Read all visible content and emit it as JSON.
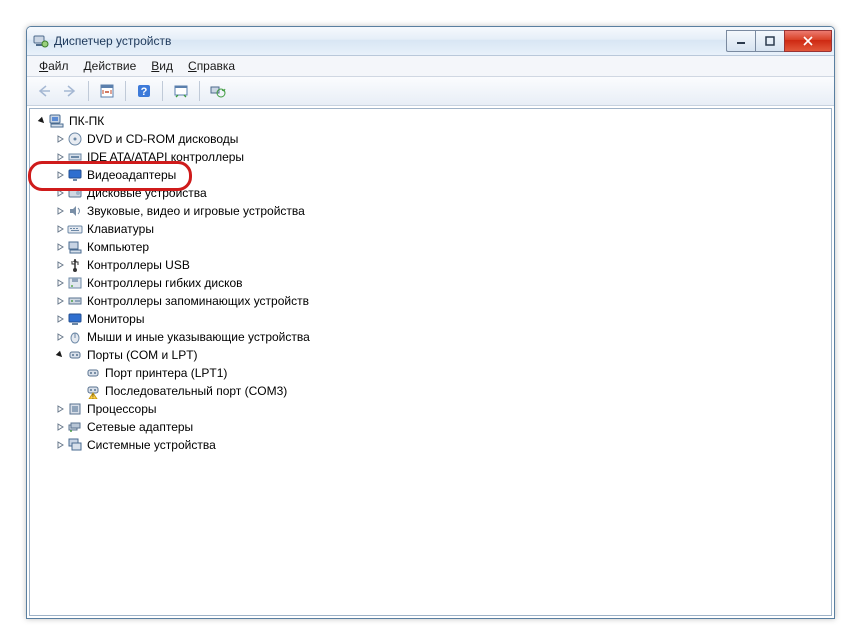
{
  "window": {
    "title": "Диспетчер устройств"
  },
  "menu": {
    "file": "Файл",
    "action": "Действие",
    "view": "Вид",
    "help": "Справка"
  },
  "tree": {
    "root": {
      "label": "ПК-ПК"
    },
    "items": [
      {
        "label": "DVD и CD-ROM дисководы",
        "icon": "disc"
      },
      {
        "label": "IDE ATA/ATAPI контроллеры",
        "icon": "ide"
      },
      {
        "label": "Видеоадаптеры",
        "icon": "display",
        "highlight": true
      },
      {
        "label": "Дисковые устройства",
        "icon": "disk"
      },
      {
        "label": "Звуковые, видео и игровые устройства",
        "icon": "sound"
      },
      {
        "label": "Клавиатуры",
        "icon": "keyboard"
      },
      {
        "label": "Компьютер",
        "icon": "computer"
      },
      {
        "label": "Контроллеры USB",
        "icon": "usb"
      },
      {
        "label": "Контроллеры гибких дисков",
        "icon": "floppyctl"
      },
      {
        "label": "Контроллеры запоминающих устройств",
        "icon": "storage"
      },
      {
        "label": "Мониторы",
        "icon": "monitor"
      },
      {
        "label": "Мыши и иные указывающие устройства",
        "icon": "mouse"
      },
      {
        "label": "Порты (COM и LPT)",
        "icon": "port",
        "expanded": true,
        "children": [
          {
            "label": "Порт принтера (LPT1)",
            "icon": "port"
          },
          {
            "label": "Последовательный порт (COM3)",
            "icon": "port-warn"
          }
        ]
      },
      {
        "label": "Процессоры",
        "icon": "cpu"
      },
      {
        "label": "Сетевые адаптеры",
        "icon": "network"
      },
      {
        "label": "Системные устройства",
        "icon": "system"
      }
    ]
  }
}
